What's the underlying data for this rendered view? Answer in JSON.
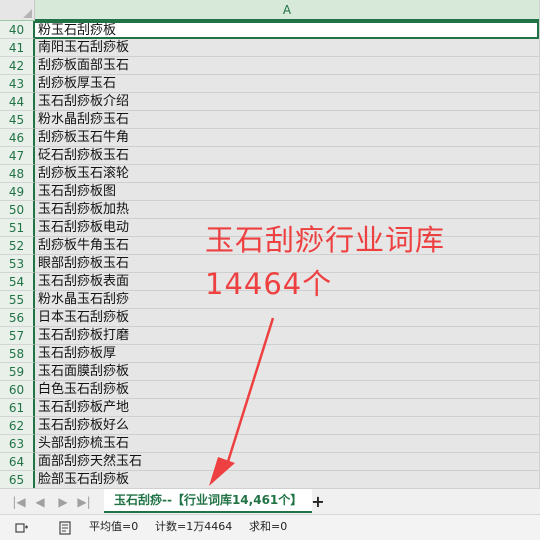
{
  "sheet": {
    "column_header": "A",
    "rows": [
      {
        "num": "40",
        "value": "粉玉石刮痧板"
      },
      {
        "num": "41",
        "value": "南阳玉石刮痧板"
      },
      {
        "num": "42",
        "value": "刮痧板面部玉石"
      },
      {
        "num": "43",
        "value": "刮痧板厚玉石"
      },
      {
        "num": "44",
        "value": "玉石刮痧板介绍"
      },
      {
        "num": "45",
        "value": "粉水晶刮痧玉石"
      },
      {
        "num": "46",
        "value": "刮痧板玉石牛角"
      },
      {
        "num": "47",
        "value": "砭石刮痧板玉石"
      },
      {
        "num": "48",
        "value": "刮痧板玉石滚轮"
      },
      {
        "num": "49",
        "value": "玉石刮痧板图"
      },
      {
        "num": "50",
        "value": "玉石刮痧板加热"
      },
      {
        "num": "51",
        "value": "玉石刮痧板电动"
      },
      {
        "num": "52",
        "value": "刮痧板牛角玉石"
      },
      {
        "num": "53",
        "value": "眼部刮痧板玉石"
      },
      {
        "num": "54",
        "value": "玉石刮痧板表面"
      },
      {
        "num": "55",
        "value": "粉水晶玉石刮痧"
      },
      {
        "num": "56",
        "value": "日本玉石刮痧板"
      },
      {
        "num": "57",
        "value": "玉石刮痧板打磨"
      },
      {
        "num": "58",
        "value": "玉石刮痧板厚"
      },
      {
        "num": "59",
        "value": "玉石面膜刮痧板"
      },
      {
        "num": "60",
        "value": "白色玉石刮痧板"
      },
      {
        "num": "61",
        "value": "玉石刮痧板产地"
      },
      {
        "num": "62",
        "value": "玉石刮痧板好么"
      },
      {
        "num": "63",
        "value": "头部刮痧梳玉石"
      },
      {
        "num": "64",
        "value": "面部刮痧天然玉石"
      },
      {
        "num": "65",
        "value": "脸部玉石刮痧板"
      }
    ]
  },
  "annotation": {
    "line1": "玉石刮痧行业词库",
    "line2": "14464个",
    "color": "#ee4040"
  },
  "tabs": {
    "nav_first_icon": "first-sheet-icon",
    "nav_prev_icon": "prev-sheet-icon",
    "nav_next_icon": "next-sheet-icon",
    "nav_last_icon": "last-sheet-icon",
    "active_sheet": "玉石刮痧--【行业词库14,461个】",
    "add_sheet_label": "+"
  },
  "status": {
    "average": "平均值=0",
    "count": "计数=1万4464",
    "sum": "求和=0"
  },
  "colors": {
    "accent": "#217346",
    "header_bg": "#d7e9d9",
    "cell_bg": "#e6e6e6"
  }
}
